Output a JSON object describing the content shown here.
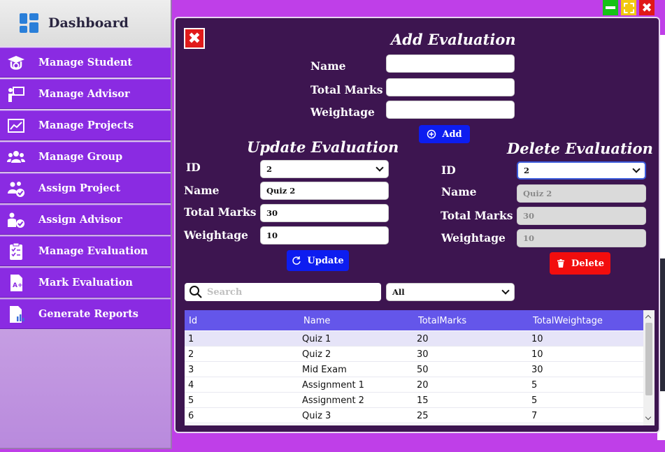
{
  "window_controls": {
    "close": "✖"
  },
  "sidebar": {
    "title": "Dashboard",
    "items": [
      {
        "label": "Manage Student",
        "icon": "graduate-icon"
      },
      {
        "label": "Manage Advisor",
        "icon": "teacher-board-icon"
      },
      {
        "label": "Manage Projects",
        "icon": "chart-image-icon"
      },
      {
        "label": "Manage Group",
        "icon": "group-icon"
      },
      {
        "label": "Assign Project",
        "icon": "users-check-icon"
      },
      {
        "label": "Assign Advisor",
        "icon": "user-check-icon"
      },
      {
        "label": "Manage Evaluation",
        "icon": "clipboard-check-icon"
      },
      {
        "label": "Mark Evaluation",
        "icon": "grade-document-icon"
      },
      {
        "label": "Generate Reports",
        "icon": "report-document-icon"
      }
    ]
  },
  "panel": {
    "close_glyph": "✖",
    "add": {
      "title": "Add Evaluation",
      "name_label": "Name",
      "total_marks_label": "Total Marks",
      "weightage_label": "Weightage",
      "name_value": "",
      "total_marks_value": "",
      "weightage_value": "",
      "button": "Add"
    },
    "update": {
      "title": "Update Evaluation",
      "id_label": "ID",
      "name_label": "Name",
      "total_marks_label": "Total Marks",
      "weightage_label": "Weightage",
      "id_value": "2",
      "name_value": "Quiz 2",
      "total_marks_value": "30",
      "weightage_value": "10",
      "button": "Update"
    },
    "delete": {
      "title": "Delete Evaluation",
      "id_label": "ID",
      "name_label": "Name",
      "total_marks_label": "Total Marks",
      "weightage_label": "Weightage",
      "id_value": "2",
      "name_value": "Quiz 2",
      "total_marks_value": "30",
      "weightage_value": "10",
      "button": "Delete"
    },
    "search": {
      "placeholder": "Search"
    },
    "filter": {
      "value": "All"
    },
    "table": {
      "columns": [
        "Id",
        "Name",
        "TotalMarks",
        "TotalWeightage"
      ],
      "rows": [
        [
          "1",
          "Quiz 1",
          "20",
          "10"
        ],
        [
          "2",
          "Quiz 2",
          "30",
          "10"
        ],
        [
          "3",
          "Mid Exam",
          "50",
          "30"
        ],
        [
          "4",
          "Assignment 1",
          "20",
          "5"
        ],
        [
          "5",
          "Assignment 2",
          "15",
          "5"
        ],
        [
          "6",
          "Quiz 3",
          "25",
          "7"
        ]
      ]
    }
  },
  "colors": {
    "page_bg": "#bf3fe8",
    "sidebar_item": "#8a2be2",
    "panel_bg": "#3d1550",
    "table_header": "#6456ea",
    "primary_button": "#0d1df0",
    "danger_button": "#f20d0d"
  }
}
